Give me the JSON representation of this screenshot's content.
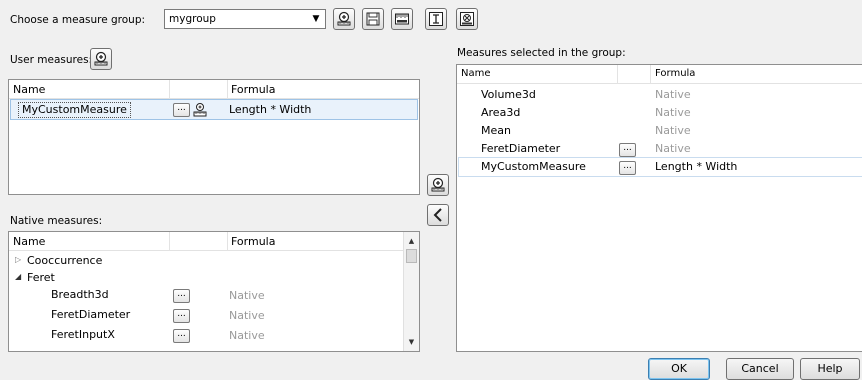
{
  "toolbar": {
    "group_label": "Choose a measure group:",
    "group_value": "mygroup",
    "icons": [
      "add-measure-icon",
      "save-icon",
      "ruler-icon",
      "text-field-icon",
      "delete-icon"
    ]
  },
  "user_measures": {
    "label": "User measures:",
    "columns": {
      "name": "Name",
      "formula": "Formula"
    },
    "rows": [
      {
        "name": "MyCustomMeasure",
        "formula": "Length * Width"
      }
    ]
  },
  "native_measures": {
    "label": "Native measures:",
    "columns": {
      "name": "Name",
      "formula": "Formula"
    },
    "tree": [
      {
        "name": "Cooccurrence",
        "expanded": false
      },
      {
        "name": "Feret",
        "expanded": true,
        "children": [
          {
            "name": "Breadth3d",
            "formula": "Native"
          },
          {
            "name": "FeretDiameter",
            "formula": "Native"
          },
          {
            "name": "FeretInputX",
            "formula": "Native"
          }
        ]
      }
    ]
  },
  "selected_measures": {
    "label": "Measures selected in the group:",
    "columns": {
      "name": "Name",
      "formula": "Formula"
    },
    "rows": [
      {
        "name": "Volume3d",
        "formula": "Native"
      },
      {
        "name": "Area3d",
        "formula": "Native"
      },
      {
        "name": "Mean",
        "formula": "Native"
      },
      {
        "name": "FeretDiameter",
        "formula": "Native"
      },
      {
        "name": "MyCustomMeasure",
        "formula": "Length * Width"
      }
    ]
  },
  "buttons": {
    "ok": "OK",
    "cancel": "Cancel",
    "help": "Help",
    "dots": "..."
  }
}
